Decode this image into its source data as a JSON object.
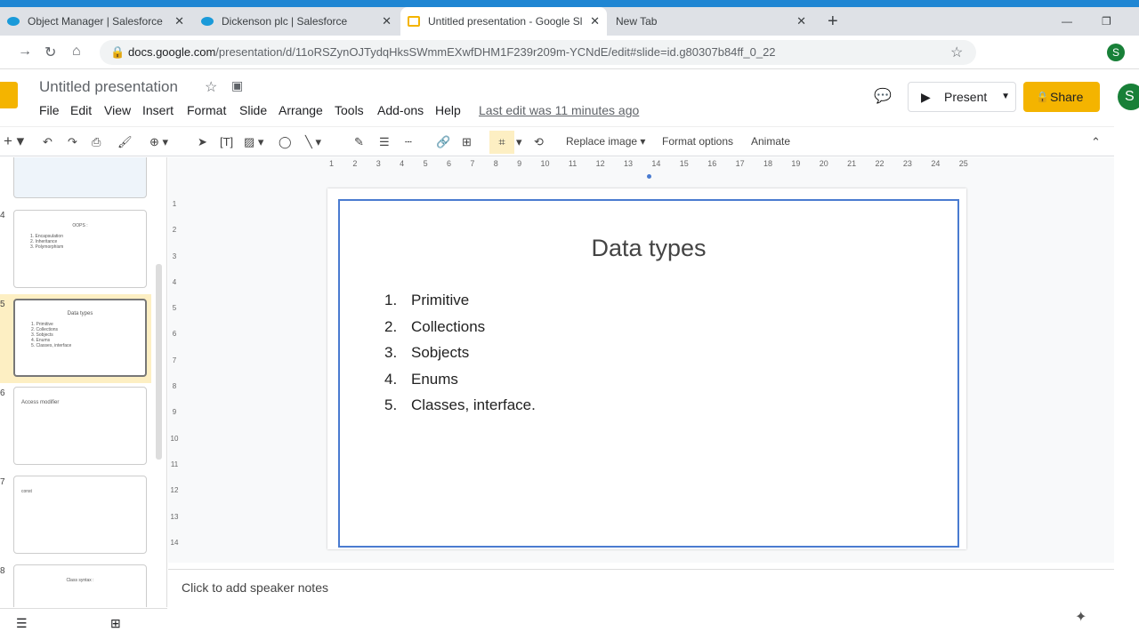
{
  "browser": {
    "tabs": [
      {
        "title": "Object Manager | Salesforce",
        "icon": "salesforce-icon"
      },
      {
        "title": "Dickenson plc | Salesforce",
        "icon": "salesforce-icon"
      },
      {
        "title": "Untitled presentation - Google Sl",
        "icon": "google-slides-icon",
        "active": true
      },
      {
        "title": "New Tab"
      }
    ],
    "url_host": "docs.google.com",
    "url_path": "/presentation/d/11oRSZynOJTydqHksSWmmEXwfDHM1F239r209m-YCNdE/edit#slide=id.g80307b84ff_0_22"
  },
  "app": {
    "title": "Untitled presentation",
    "menus": [
      "File",
      "Edit",
      "View",
      "Insert",
      "Format",
      "Slide",
      "Arrange",
      "Tools",
      "Add-ons",
      "Help"
    ],
    "last_edit": "Last edit was 11 minutes ago",
    "present_label": "Present",
    "share_label": "Share",
    "accent": "#f4b400"
  },
  "toolbar": {
    "replace_image": "Replace image",
    "format_options": "Format options",
    "animate": "Animate"
  },
  "filmstrip": [
    {
      "num": "4",
      "title": "OOPS :",
      "items": [
        "1. Encapsulation",
        "2. Inheritance",
        "3. Polymorphism"
      ]
    },
    {
      "num": "5",
      "title": "Data types",
      "items": [
        "1. Primitive",
        "2. Collections",
        "3. Sobjects",
        "4. Enums",
        "5. Classes, interface"
      ],
      "selected": true
    },
    {
      "num": "6",
      "title": "Access modifier"
    },
    {
      "num": "7",
      "title": "const"
    },
    {
      "num": "8",
      "title": "Class syntax :"
    }
  ],
  "ruler_h": [
    "1",
    "2",
    "3",
    "4",
    "5",
    "6",
    "7",
    "8",
    "9",
    "10",
    "11",
    "12",
    "13",
    "14",
    "15",
    "16",
    "17",
    "18",
    "19",
    "20",
    "21",
    "22",
    "23",
    "24",
    "25"
  ],
  "ruler_v": [
    "1",
    "2",
    "3",
    "4",
    "5",
    "6",
    "7",
    "8",
    "9",
    "10",
    "11",
    "12",
    "13",
    "14"
  ],
  "slide": {
    "title": "Data types",
    "items": [
      {
        "n": "1.",
        "t": "Primitive"
      },
      {
        "n": "2.",
        "t": "Collections"
      },
      {
        "n": "3.",
        "t": "Sobjects"
      },
      {
        "n": "4.",
        "t": "Enums"
      },
      {
        "n": "5.",
        "t": "Classes, interface."
      }
    ]
  },
  "notes_placeholder": "Click to add speaker notes"
}
